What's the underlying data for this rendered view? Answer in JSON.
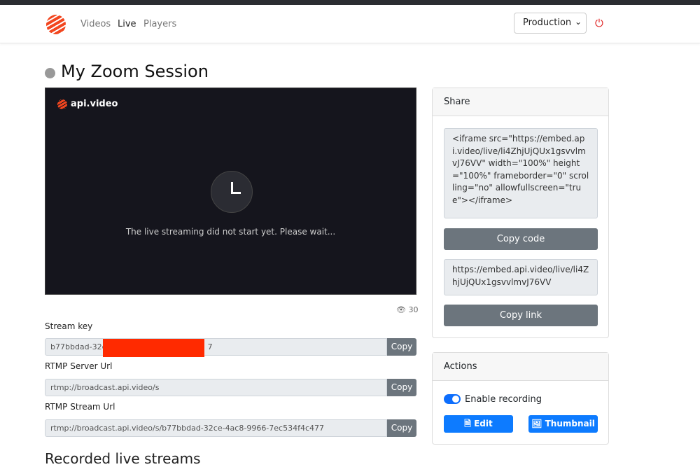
{
  "nav": {
    "links": [
      "Videos",
      "Live",
      "Players"
    ],
    "active": "Live",
    "environment": "Production"
  },
  "page": {
    "title": "My Zoom Session"
  },
  "player": {
    "brand": "api.video",
    "message": "The live streaming did not start yet. Please wait...",
    "views": "30"
  },
  "fields": [
    {
      "label": "Stream key",
      "value": "b77bbdad-32c",
      "value_tail": "7",
      "button": "Copy"
    },
    {
      "label": "RTMP Server Url",
      "value": "rtmp://broadcast.api.video/s",
      "button": "Copy"
    },
    {
      "label": "RTMP Stream Url",
      "value": "rtmp://broadcast.api.video/s/b77bbdad-32ce-4ac8-9966-7ec534f4c477",
      "button": "Copy"
    }
  ],
  "recorded": {
    "heading": "Recorded live streams"
  },
  "share": {
    "title": "Share",
    "embed_code": "<iframe src=\"https://embed.api.video/live/li4ZhjUjQUx1gsvvlmvJ76VV\" width=\"100%\" height=\"100%\" frameborder=\"0\" scrolling=\"no\" allowfullscreen=\"true\"></iframe>",
    "copy_code": "Copy code",
    "link": "https://embed.api.video/live/li4ZhjUjQUx1gsvvlmvJ76VV",
    "copy_link": "Copy link"
  },
  "actions": {
    "title": "Actions",
    "recording_label": "Enable recording",
    "recording_enabled": true,
    "edit": "Edit",
    "thumbnail": "Thumbnail"
  },
  "colors": {
    "primary": "#0d7bff",
    "secondary": "#6c757d",
    "brand": "#f2461f",
    "power": "#e02020"
  }
}
